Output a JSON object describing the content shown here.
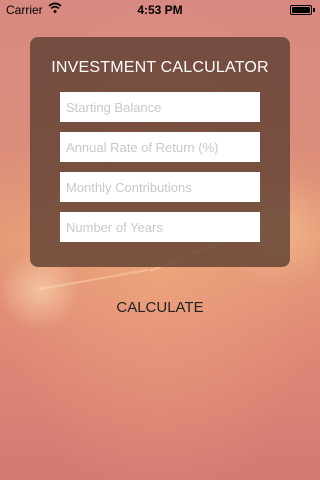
{
  "status_bar": {
    "carrier": "Carrier",
    "wifi_icon": "wifi-icon",
    "time": "4:53 PM",
    "battery_icon": "battery-icon"
  },
  "calculator": {
    "title": "INVESTMENT CALCULATOR",
    "fields": [
      {
        "placeholder": "Starting Balance",
        "value": ""
      },
      {
        "placeholder": "Annual Rate of Return (%)",
        "value": ""
      },
      {
        "placeholder": "Monthly Contributions",
        "value": ""
      },
      {
        "placeholder": "Number of Years",
        "value": ""
      }
    ],
    "calculate_label": "CALCULATE"
  },
  "colors": {
    "panel": "#5a3c30",
    "background_top": "#d88a82",
    "background_mid": "#e79c78",
    "background_bottom": "#d47874"
  }
}
